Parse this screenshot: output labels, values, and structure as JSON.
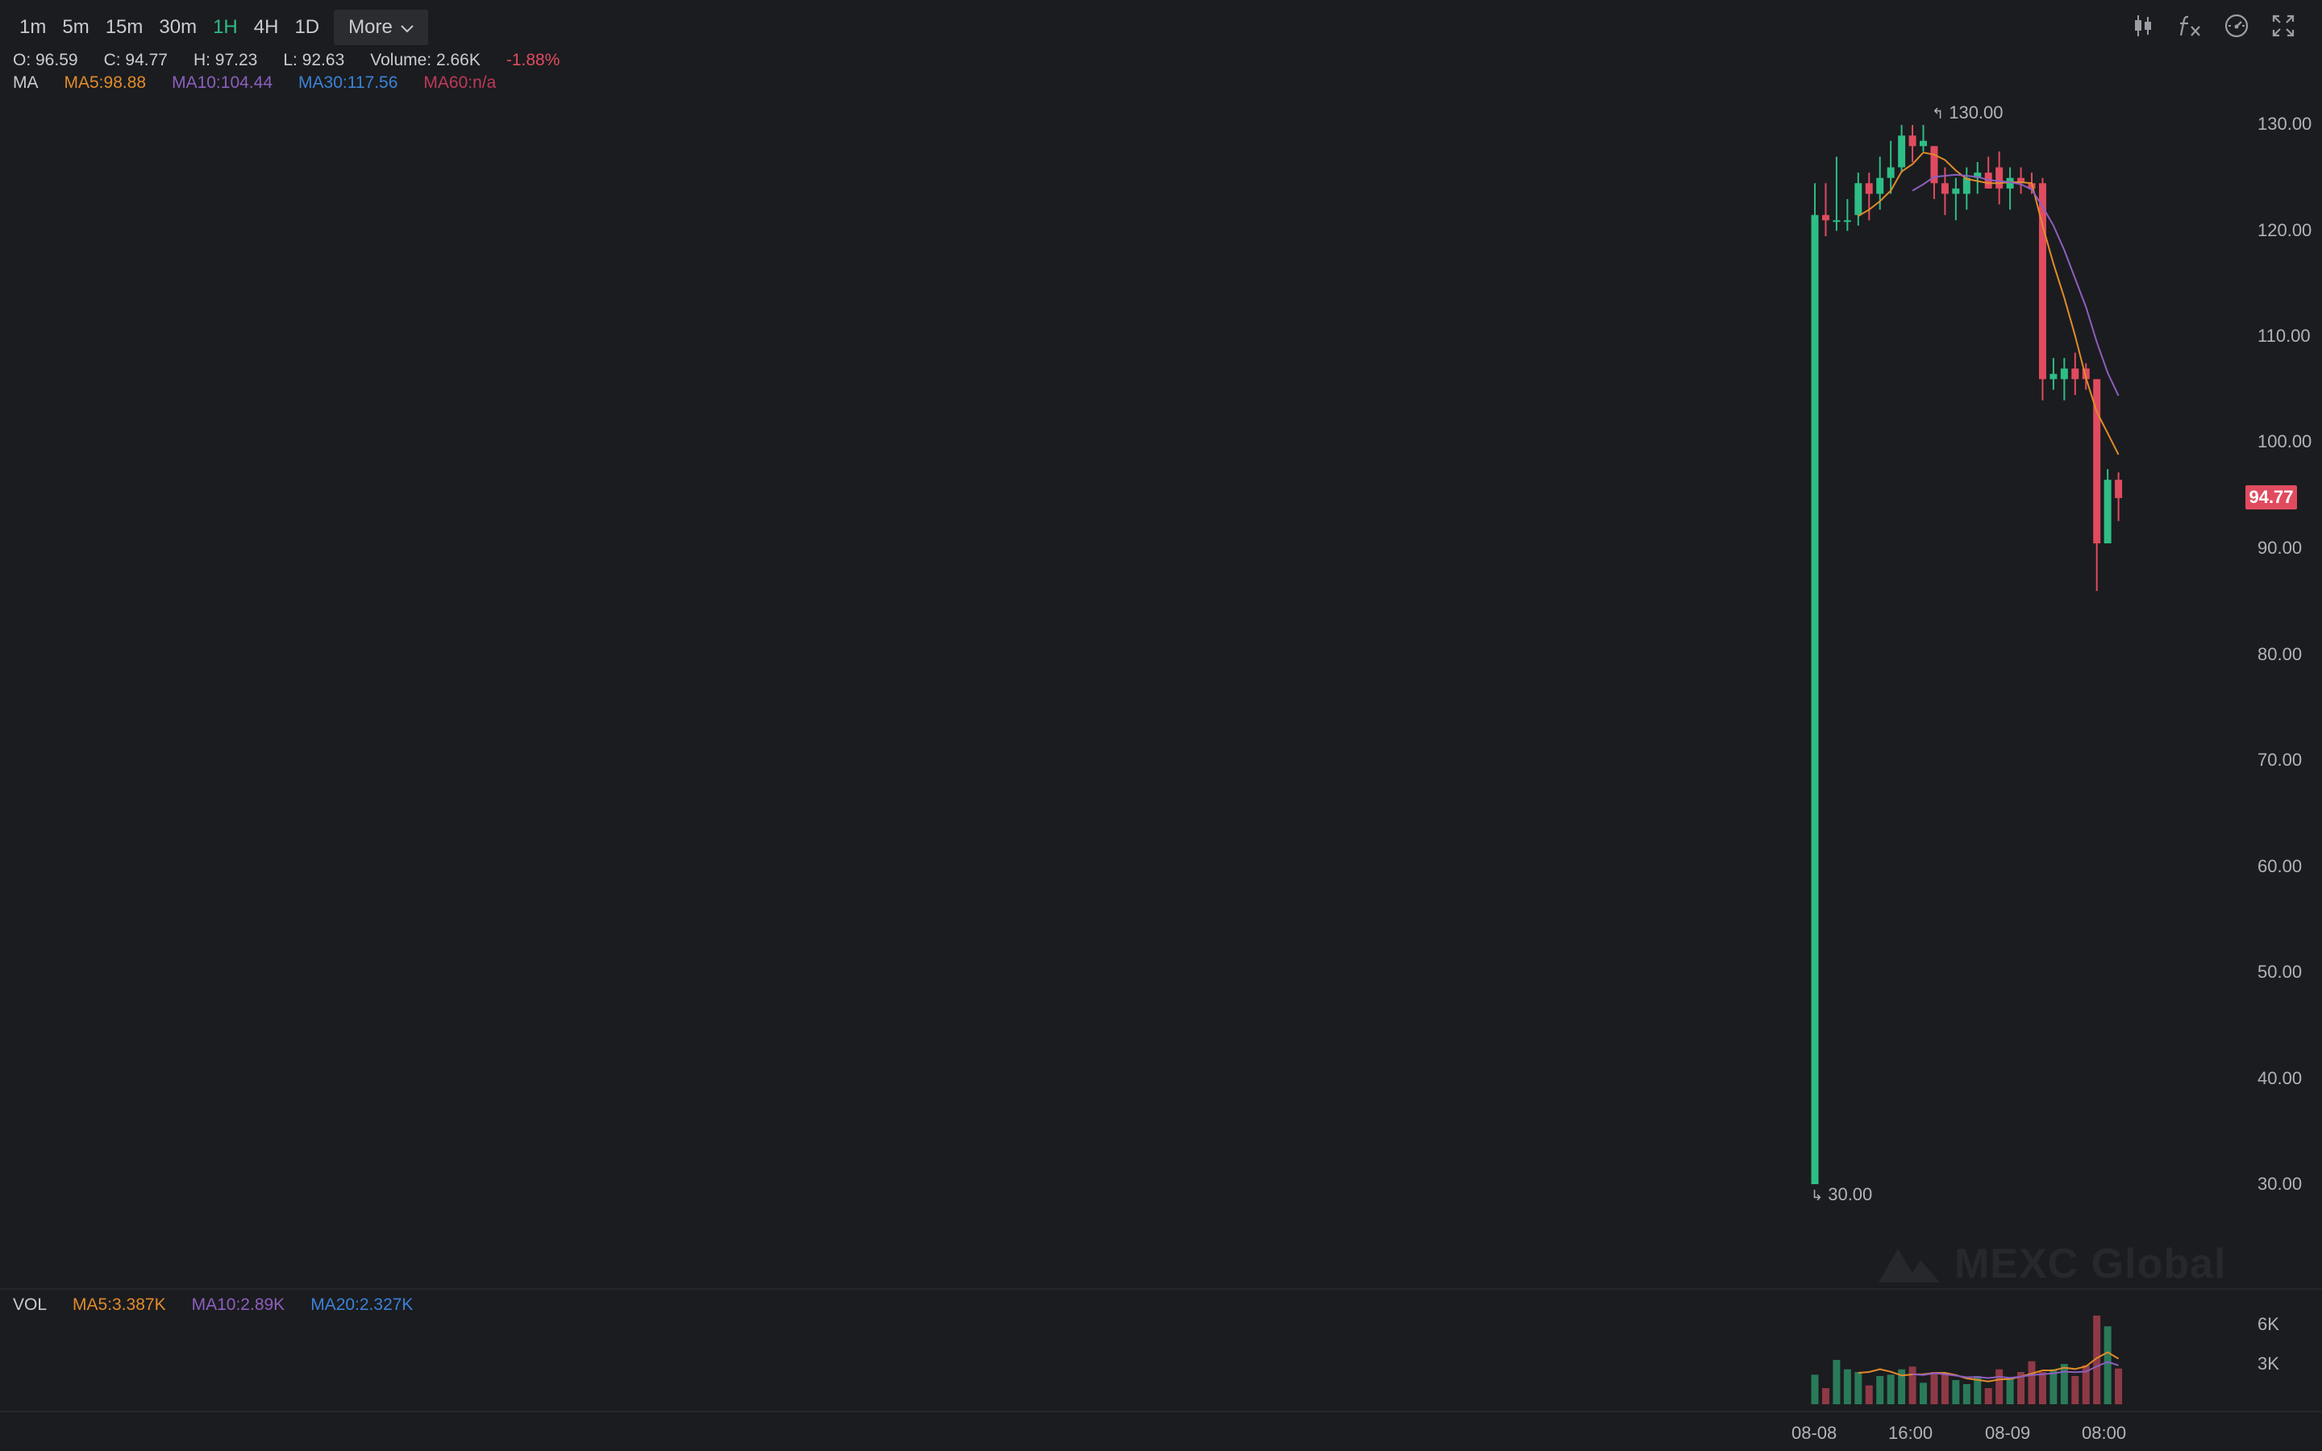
{
  "toolbar": {
    "timeframes": [
      "1m",
      "5m",
      "15m",
      "30m",
      "1H",
      "4H",
      "1D"
    ],
    "active_timeframe": "1H",
    "more_label": "More",
    "icons": [
      "candlestick-type-icon",
      "indicator-fx-icon",
      "chart-settings-icon",
      "fullscreen-icon"
    ]
  },
  "ohlc": {
    "open": "O: 96.59",
    "close": "C: 94.77",
    "high": "H: 97.23",
    "low": "L: 92.63",
    "volume": "Volume: 2.66K",
    "change": "-1.88%"
  },
  "ma_legend": {
    "label": "MA",
    "ma5": "MA5:98.88",
    "ma10": "MA10:104.44",
    "ma30": "MA30:117.56",
    "ma60": "MA60:n/a"
  },
  "vol_legend": {
    "label": "VOL",
    "ma5": "MA5:3.387K",
    "ma10": "MA10:2.89K",
    "ma20": "MA20:2.327K"
  },
  "price_axis": [
    "130.00",
    "120.00",
    "110.00",
    "100.00",
    "90.00",
    "80.00",
    "70.00",
    "60.00",
    "50.00",
    "40.00",
    "30.00"
  ],
  "volume_axis": [
    "6K",
    "3K"
  ],
  "time_axis": [
    "08-08",
    "16:00",
    "08-09",
    "08:00"
  ],
  "last_price": "94.77",
  "high_marker": "130.00",
  "low_marker": "30.00",
  "watermark": "MEXC Global",
  "colors": {
    "up": "#2ebd85",
    "down": "#e04b5f",
    "ma5": "#e08c2c",
    "ma10": "#8c5fbf",
    "ma30": "#3b82d6",
    "ma60": "#c0395a",
    "background": "#1b1c1f"
  },
  "chart_data": {
    "type": "candlestick",
    "price_range": [
      20,
      132
    ],
    "volume_range": [
      0,
      7000
    ],
    "grid": false,
    "candles": [
      {
        "o": 30.0,
        "h": 124.5,
        "l": 30.0,
        "c": 121.5,
        "v": 2200
      },
      {
        "o": 121.5,
        "h": 124.5,
        "l": 119.5,
        "c": 121.0,
        "v": 1200
      },
      {
        "o": 121.0,
        "h": 127.0,
        "l": 120.0,
        "c": 121.0,
        "v": 3300
      },
      {
        "o": 121.0,
        "h": 123.0,
        "l": 120.0,
        "c": 121.0,
        "v": 2600
      },
      {
        "o": 121.5,
        "h": 125.5,
        "l": 120.5,
        "c": 124.5,
        "v": 2400
      },
      {
        "o": 124.5,
        "h": 125.5,
        "l": 121.0,
        "c": 123.5,
        "v": 1400
      },
      {
        "o": 123.5,
        "h": 127.0,
        "l": 122.0,
        "c": 125.0,
        "v": 2100
      },
      {
        "o": 125.0,
        "h": 128.5,
        "l": 123.5,
        "c": 126.0,
        "v": 2200
      },
      {
        "o": 126.0,
        "h": 130.0,
        "l": 125.5,
        "c": 129.0,
        "v": 2600
      },
      {
        "o": 129.0,
        "h": 130.0,
        "l": 126.5,
        "c": 128.0,
        "v": 2800
      },
      {
        "o": 128.0,
        "h": 130.0,
        "l": 127.5,
        "c": 128.5,
        "v": 1600
      },
      {
        "o": 128.0,
        "h": 128.0,
        "l": 123.0,
        "c": 124.5,
        "v": 2400
      },
      {
        "o": 124.5,
        "h": 126.0,
        "l": 121.5,
        "c": 123.5,
        "v": 2300
      },
      {
        "o": 123.5,
        "h": 125.0,
        "l": 121.0,
        "c": 124.0,
        "v": 1800
      },
      {
        "o": 123.5,
        "h": 126.0,
        "l": 122.0,
        "c": 125.0,
        "v": 1500
      },
      {
        "o": 125.0,
        "h": 126.5,
        "l": 123.5,
        "c": 125.5,
        "v": 2100
      },
      {
        "o": 125.5,
        "h": 127.0,
        "l": 124.0,
        "c": 124.0,
        "v": 1200
      },
      {
        "o": 126.0,
        "h": 127.5,
        "l": 122.5,
        "c": 124.0,
        "v": 2600
      },
      {
        "o": 124.0,
        "h": 126.0,
        "l": 122.0,
        "c": 125.0,
        "v": 2000
      },
      {
        "o": 125.0,
        "h": 126.0,
        "l": 123.5,
        "c": 124.5,
        "v": 2400
      },
      {
        "o": 124.5,
        "h": 125.5,
        "l": 123.5,
        "c": 124.0,
        "v": 3200
      },
      {
        "o": 124.5,
        "h": 125.0,
        "l": 104.0,
        "c": 106.0,
        "v": 2400
      },
      {
        "o": 106.0,
        "h": 108.0,
        "l": 105.0,
        "c": 106.5,
        "v": 2600
      },
      {
        "o": 106.0,
        "h": 108.0,
        "l": 104.0,
        "c": 107.0,
        "v": 3000
      },
      {
        "o": 107.0,
        "h": 108.5,
        "l": 104.5,
        "c": 106.0,
        "v": 2100
      },
      {
        "o": 107.0,
        "h": 107.5,
        "l": 105.0,
        "c": 106.0,
        "v": 2900
      },
      {
        "o": 106.0,
        "h": 106.0,
        "l": 86.0,
        "c": 90.5,
        "v": 6600
      },
      {
        "o": 90.5,
        "h": 97.5,
        "l": 90.5,
        "c": 96.5,
        "v": 5800
      },
      {
        "o": 96.5,
        "h": 97.2,
        "l": 92.6,
        "c": 94.77,
        "v": 2660
      }
    ],
    "ma5": [
      null,
      null,
      null,
      null,
      121.4,
      122.0,
      122.8,
      123.8,
      125.6,
      126.3,
      127.4,
      127.2,
      126.7,
      125.7,
      124.9,
      124.7,
      124.5,
      124.5,
      124.6,
      124.6,
      124.5,
      120.5,
      116.9,
      113.7,
      110.1,
      106.1,
      102.9,
      100.9,
      98.88
    ],
    "ma10": [
      null,
      null,
      null,
      null,
      null,
      null,
      null,
      null,
      null,
      123.8,
      124.4,
      125.1,
      125.2,
      125.3,
      125.2,
      125.1,
      124.8,
      124.7,
      124.6,
      124.4,
      123.9,
      122.3,
      120.5,
      118.2,
      115.5,
      112.8,
      109.5,
      106.6,
      104.44
    ],
    "vol_ma5": [
      null,
      null,
      null,
      null,
      2340,
      2400,
      2610,
      2420,
      2140,
      2220,
      2240,
      2320,
      2340,
      2180,
      1920,
      1820,
      1700,
      1840,
      1880,
      2060,
      2280,
      2520,
      2520,
      2720,
      2620,
      2820,
      3440,
      3870,
      3387
    ],
    "vol_ma10": [
      null,
      null,
      null,
      null,
      null,
      null,
      null,
      null,
      null,
      2240,
      2180,
      2310,
      2230,
      2130,
      2010,
      2030,
      1950,
      2040,
      1960,
      2050,
      2170,
      2240,
      2300,
      2430,
      2380,
      2430,
      2820,
      3150,
      2890
    ]
  }
}
